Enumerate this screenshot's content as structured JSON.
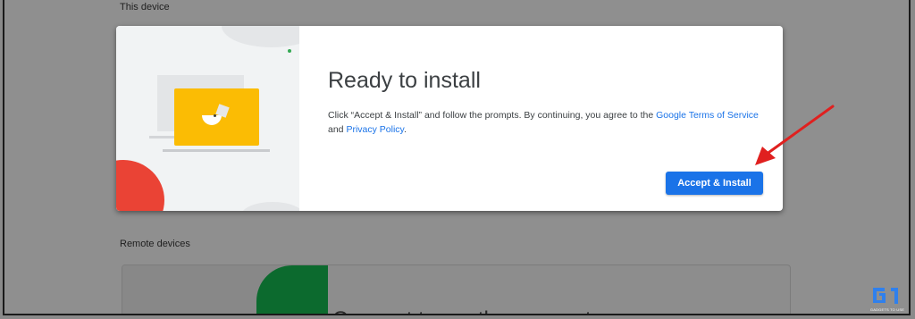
{
  "sections": {
    "this_device": "This device",
    "remote_devices": "Remote devices"
  },
  "dialog": {
    "title": "Ready to install",
    "body_prefix": "Click “Accept & Install” and follow the prompts. By continuing, you agree to the ",
    "terms_link": "Google Terms of Service",
    "body_middle": " and ",
    "privacy_link": "Privacy Policy",
    "body_suffix": ".",
    "accept_button": "Accept & Install"
  },
  "background_card": {
    "title": "Connect to another computer"
  },
  "watermark": {
    "logo": "G1",
    "text": "GADGETS TO USE"
  },
  "colors": {
    "accent": "#1a73e8",
    "arrow": "#e0201f",
    "illustration_yellow": "#fbbc04",
    "illustration_red": "#ea4335",
    "illustration_green": "#34a853"
  },
  "icons": [
    "laptop-illustration-icon",
    "red-arrow-icon",
    "watermark-logo-icon"
  ]
}
